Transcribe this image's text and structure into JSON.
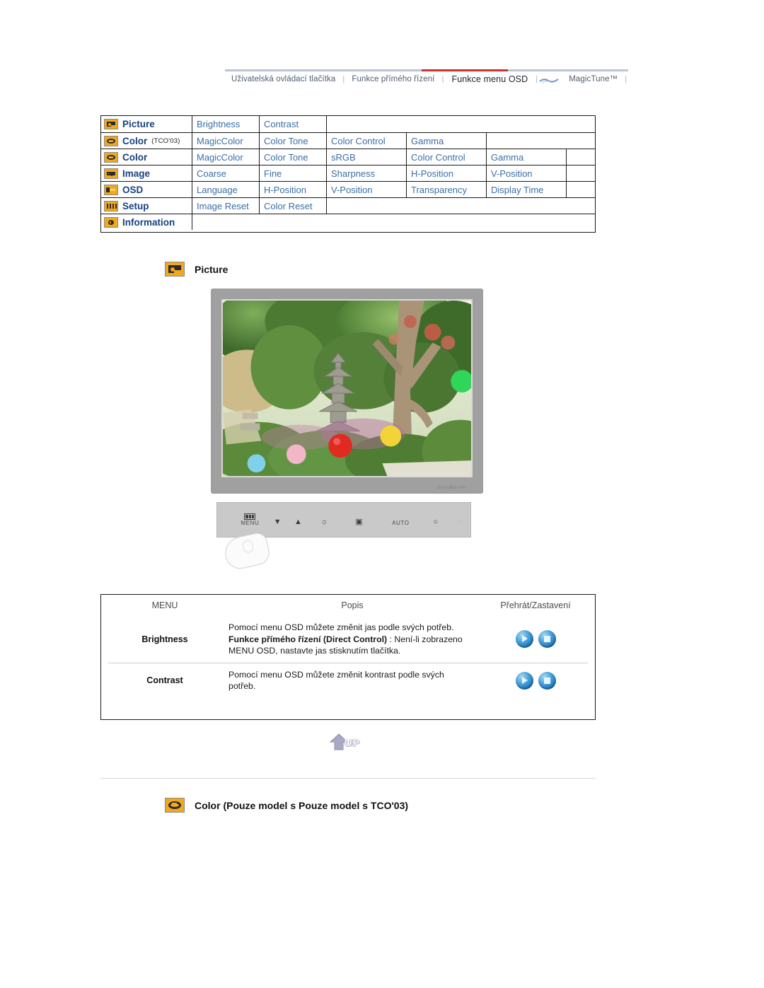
{
  "topnav": {
    "items": [
      {
        "label": "Uživatelská ovládací tlačítka",
        "active": false
      },
      {
        "label": "Funkce přímého řízení",
        "active": false
      },
      {
        "label": "Funkce menu OSD",
        "active": true
      },
      {
        "label": "MagicTune™",
        "active": false
      }
    ],
    "separator": "|",
    "accent_color": "#c8332c",
    "rule_color": "#b9c4d4"
  },
  "menu_matrix": {
    "rows": [
      {
        "icon": "picture-icon",
        "label": "Picture",
        "sub": "",
        "items": [
          "Brightness",
          "Contrast"
        ]
      },
      {
        "icon": "color-icon",
        "label": "Color",
        "sub": "(TCO'03)",
        "items": [
          "MagicColor",
          "Color Tone",
          "Color Control",
          "Gamma"
        ]
      },
      {
        "icon": "color-icon",
        "label": "Color",
        "sub": "",
        "items": [
          "MagicColor",
          "Color Tone",
          "sRGB",
          "Color Control",
          "Gamma"
        ]
      },
      {
        "icon": "image-icon",
        "label": "Image",
        "sub": "",
        "items": [
          "Coarse",
          "Fine",
          "Sharpness",
          "H-Position",
          "V-Position"
        ]
      },
      {
        "icon": "osd-icon",
        "label": "OSD",
        "sub": "",
        "items": [
          "Language",
          "H-Position",
          "V-Position",
          "Transparency",
          "Display Time"
        ]
      },
      {
        "icon": "setup-icon",
        "label": "Setup",
        "sub": "",
        "items": [
          "Image Reset",
          "Color Reset"
        ]
      },
      {
        "icon": "information-icon",
        "label": "Information",
        "sub": "",
        "items": []
      }
    ],
    "header_text_color": "#17427f",
    "cell_text_color": "#3b6ea8"
  },
  "picture_section": {
    "heading": "Picture",
    "icon": "picture-icon",
    "monitor": {
      "screen_alt": "Zahradní scéna s kamennou pagodou a barevnými lampiony",
      "brand_mark": "SyncMaster"
    },
    "control_panel": {
      "buttons": [
        {
          "name": "menu-button",
          "glyph": "",
          "label": "MENU"
        },
        {
          "name": "down-button",
          "glyph": "▼",
          "label": ""
        },
        {
          "name": "up-button",
          "glyph": "▲",
          "label": ""
        },
        {
          "name": "brightness-button",
          "glyph": "☼",
          "label": ""
        },
        {
          "name": "source-button",
          "glyph": "▣",
          "label": ""
        },
        {
          "name": "auto-button",
          "glyph": "",
          "label": "AUTO"
        },
        {
          "name": "power-button",
          "glyph": "○",
          "label": ""
        },
        {
          "name": "power-led",
          "glyph": "▪",
          "label": ""
        }
      ]
    }
  },
  "desc_table": {
    "headers": {
      "menu": "MENU",
      "popis": "Popis",
      "play_stop": "Přehrát/Zastavení"
    },
    "rows": [
      {
        "menu": "Brightness",
        "desc_part1": "Pomocí menu OSD můžete změnit jas podle svých potřeb.",
        "desc_bold": "Funkce přímého řízení (Direct Control)",
        "desc_part2": " : Není-li zobrazeno MENU OSD, nastavte jas stisknutím tlačítka.",
        "play_label": "play-orb",
        "stop_label": "stop-orb"
      },
      {
        "menu": "Contrast",
        "desc_part1": "Pomocí menu OSD můžete změnit kontrast podle svých potřeb.",
        "desc_bold": "",
        "desc_part2": "",
        "play_label": "play-orb",
        "stop_label": "stop-orb"
      }
    ]
  },
  "up_button": {
    "label": "UP"
  },
  "color_section": {
    "heading": "Color (Pouze model s Pouze model s TCO'03)",
    "icon": "color-icon"
  }
}
